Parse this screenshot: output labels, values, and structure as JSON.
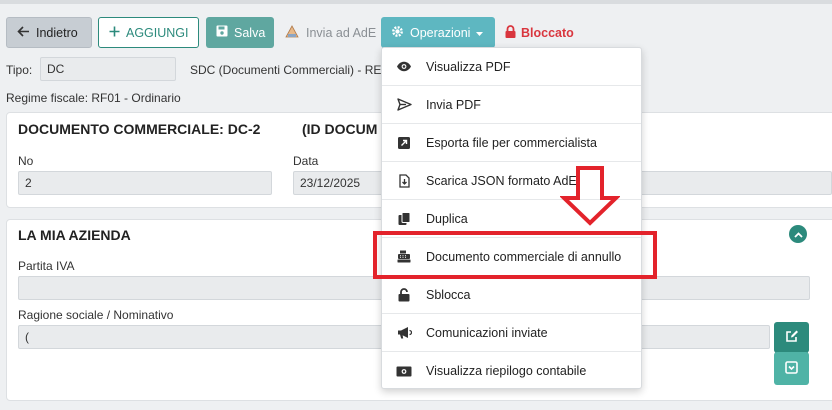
{
  "toolbar": {
    "back_label": "Indietro",
    "add_label": "AGGIUNGI",
    "save_label": "Salva",
    "send_ade_label": "Invia ad AdE",
    "operations_label": "Operazioni",
    "locked_label": "Bloccato"
  },
  "header": {
    "tipo_label": "Tipo:",
    "tipo_value": "DC",
    "sdc_text": "SDC (Documenti Commerciali) - RE",
    "regime_text": "Regime fiscale: RF01 - Ordinario"
  },
  "document_card": {
    "title": "DOCUMENTO COMMERCIALE: DC-2",
    "title_id": "(ID DOCUM",
    "no_label": "No",
    "no_value": "2",
    "data_label": "Data",
    "data_value": "23/12/2025"
  },
  "company_card": {
    "title": "LA MIA AZIENDA",
    "partita_iva_label": "Partita IVA",
    "partita_iva_value": "",
    "ragione_label": "Ragione sociale / Nominativo",
    "ragione_value": "("
  },
  "menu": {
    "items": [
      {
        "label": "Visualizza PDF",
        "icon": "eye-icon"
      },
      {
        "label": "Invia PDF",
        "icon": "send-icon"
      },
      {
        "label": "Esporta file per commercialista",
        "icon": "external-link-icon"
      },
      {
        "label": "Scarica JSON formato AdE",
        "icon": "download-file-icon"
      },
      {
        "label": "Duplica",
        "icon": "copy-icon"
      },
      {
        "label": "Documento commerciale di annullo",
        "icon": "cash-register-icon"
      },
      {
        "label": "Sblocca",
        "icon": "unlock-icon"
      },
      {
        "label": "Comunicazioni inviate",
        "icon": "megaphone-icon"
      },
      {
        "label": "Visualizza riepilogo contabile",
        "icon": "money-bill-icon"
      }
    ]
  },
  "colors": {
    "primary_teal": "#2c8a7c",
    "operations": "#5eb7c1",
    "danger": "#d9363e",
    "highlight": "#e3232b"
  }
}
